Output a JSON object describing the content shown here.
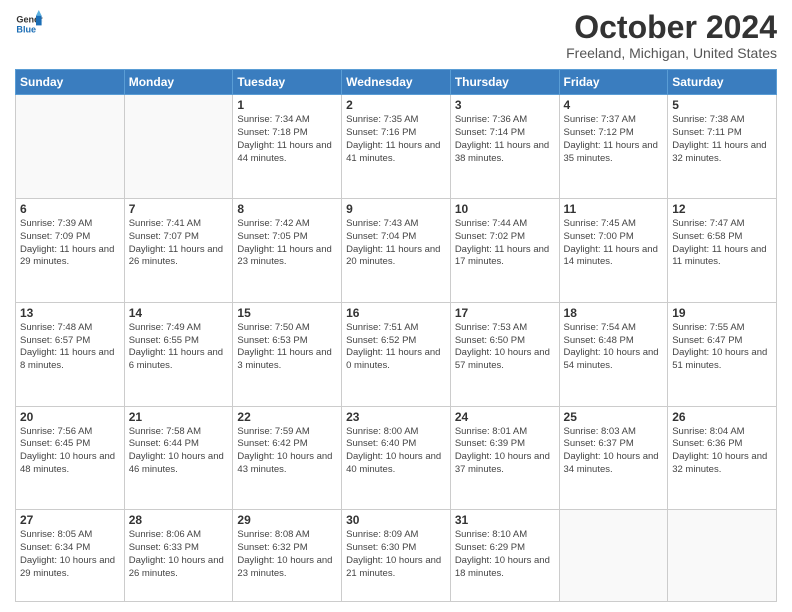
{
  "header": {
    "logo_line1": "General",
    "logo_line2": "Blue",
    "month": "October 2024",
    "location": "Freeland, Michigan, United States"
  },
  "weekdays": [
    "Sunday",
    "Monday",
    "Tuesday",
    "Wednesday",
    "Thursday",
    "Friday",
    "Saturday"
  ],
  "weeks": [
    [
      {
        "day": "",
        "info": ""
      },
      {
        "day": "",
        "info": ""
      },
      {
        "day": "1",
        "info": "Sunrise: 7:34 AM\nSunset: 7:18 PM\nDaylight: 11 hours and 44 minutes."
      },
      {
        "day": "2",
        "info": "Sunrise: 7:35 AM\nSunset: 7:16 PM\nDaylight: 11 hours and 41 minutes."
      },
      {
        "day": "3",
        "info": "Sunrise: 7:36 AM\nSunset: 7:14 PM\nDaylight: 11 hours and 38 minutes."
      },
      {
        "day": "4",
        "info": "Sunrise: 7:37 AM\nSunset: 7:12 PM\nDaylight: 11 hours and 35 minutes."
      },
      {
        "day": "5",
        "info": "Sunrise: 7:38 AM\nSunset: 7:11 PM\nDaylight: 11 hours and 32 minutes."
      }
    ],
    [
      {
        "day": "6",
        "info": "Sunrise: 7:39 AM\nSunset: 7:09 PM\nDaylight: 11 hours and 29 minutes."
      },
      {
        "day": "7",
        "info": "Sunrise: 7:41 AM\nSunset: 7:07 PM\nDaylight: 11 hours and 26 minutes."
      },
      {
        "day": "8",
        "info": "Sunrise: 7:42 AM\nSunset: 7:05 PM\nDaylight: 11 hours and 23 minutes."
      },
      {
        "day": "9",
        "info": "Sunrise: 7:43 AM\nSunset: 7:04 PM\nDaylight: 11 hours and 20 minutes."
      },
      {
        "day": "10",
        "info": "Sunrise: 7:44 AM\nSunset: 7:02 PM\nDaylight: 11 hours and 17 minutes."
      },
      {
        "day": "11",
        "info": "Sunrise: 7:45 AM\nSunset: 7:00 PM\nDaylight: 11 hours and 14 minutes."
      },
      {
        "day": "12",
        "info": "Sunrise: 7:47 AM\nSunset: 6:58 PM\nDaylight: 11 hours and 11 minutes."
      }
    ],
    [
      {
        "day": "13",
        "info": "Sunrise: 7:48 AM\nSunset: 6:57 PM\nDaylight: 11 hours and 8 minutes."
      },
      {
        "day": "14",
        "info": "Sunrise: 7:49 AM\nSunset: 6:55 PM\nDaylight: 11 hours and 6 minutes."
      },
      {
        "day": "15",
        "info": "Sunrise: 7:50 AM\nSunset: 6:53 PM\nDaylight: 11 hours and 3 minutes."
      },
      {
        "day": "16",
        "info": "Sunrise: 7:51 AM\nSunset: 6:52 PM\nDaylight: 11 hours and 0 minutes."
      },
      {
        "day": "17",
        "info": "Sunrise: 7:53 AM\nSunset: 6:50 PM\nDaylight: 10 hours and 57 minutes."
      },
      {
        "day": "18",
        "info": "Sunrise: 7:54 AM\nSunset: 6:48 PM\nDaylight: 10 hours and 54 minutes."
      },
      {
        "day": "19",
        "info": "Sunrise: 7:55 AM\nSunset: 6:47 PM\nDaylight: 10 hours and 51 minutes."
      }
    ],
    [
      {
        "day": "20",
        "info": "Sunrise: 7:56 AM\nSunset: 6:45 PM\nDaylight: 10 hours and 48 minutes."
      },
      {
        "day": "21",
        "info": "Sunrise: 7:58 AM\nSunset: 6:44 PM\nDaylight: 10 hours and 46 minutes."
      },
      {
        "day": "22",
        "info": "Sunrise: 7:59 AM\nSunset: 6:42 PM\nDaylight: 10 hours and 43 minutes."
      },
      {
        "day": "23",
        "info": "Sunrise: 8:00 AM\nSunset: 6:40 PM\nDaylight: 10 hours and 40 minutes."
      },
      {
        "day": "24",
        "info": "Sunrise: 8:01 AM\nSunset: 6:39 PM\nDaylight: 10 hours and 37 minutes."
      },
      {
        "day": "25",
        "info": "Sunrise: 8:03 AM\nSunset: 6:37 PM\nDaylight: 10 hours and 34 minutes."
      },
      {
        "day": "26",
        "info": "Sunrise: 8:04 AM\nSunset: 6:36 PM\nDaylight: 10 hours and 32 minutes."
      }
    ],
    [
      {
        "day": "27",
        "info": "Sunrise: 8:05 AM\nSunset: 6:34 PM\nDaylight: 10 hours and 29 minutes."
      },
      {
        "day": "28",
        "info": "Sunrise: 8:06 AM\nSunset: 6:33 PM\nDaylight: 10 hours and 26 minutes."
      },
      {
        "day": "29",
        "info": "Sunrise: 8:08 AM\nSunset: 6:32 PM\nDaylight: 10 hours and 23 minutes."
      },
      {
        "day": "30",
        "info": "Sunrise: 8:09 AM\nSunset: 6:30 PM\nDaylight: 10 hours and 21 minutes."
      },
      {
        "day": "31",
        "info": "Sunrise: 8:10 AM\nSunset: 6:29 PM\nDaylight: 10 hours and 18 minutes."
      },
      {
        "day": "",
        "info": ""
      },
      {
        "day": "",
        "info": ""
      }
    ]
  ]
}
